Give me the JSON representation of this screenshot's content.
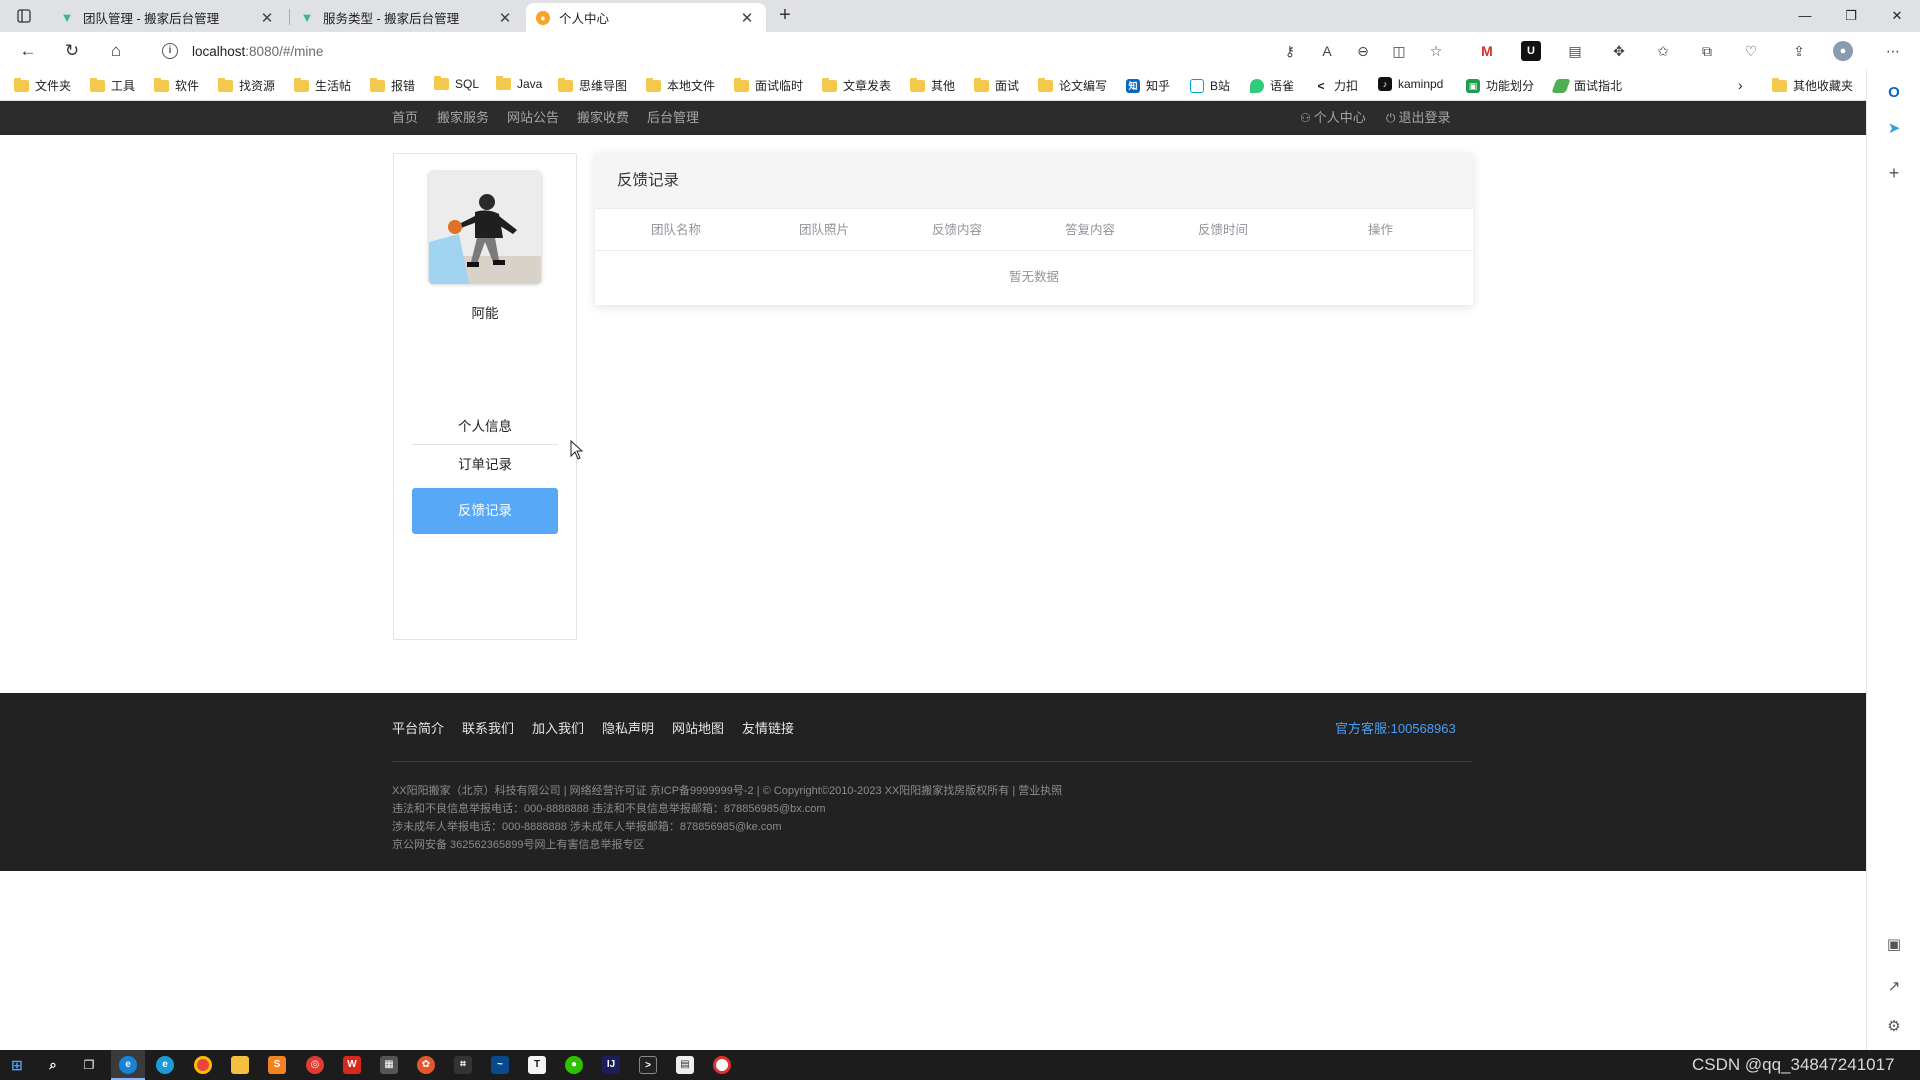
{
  "browser": {
    "tabs": [
      {
        "title": "团队管理 - 搬家后台管理",
        "active": false
      },
      {
        "title": "服务类型 - 搬家后台管理",
        "active": false
      },
      {
        "title": "个人中心",
        "active": true
      }
    ],
    "url_host": "localhost",
    "url_path": ":8080/#/mine",
    "bookmarks": [
      "文件夹",
      "工具",
      "软件",
      "找资源",
      "生活帖",
      "报错",
      "SQL",
      "Java",
      "思维导图",
      "本地文件",
      "面试临时",
      "文章发表",
      "其他",
      "面试",
      "论文编写",
      "知乎",
      "B站",
      "语雀",
      "力扣",
      "kaminpd",
      "功能划分",
      "面试指北"
    ],
    "other_bookmarks": "其他收藏夹",
    "bookmark_icons": {
      "zhihu": "知",
      "tiktok": "♪",
      "feishu": "▣"
    }
  },
  "nav": {
    "items": [
      "首页",
      "搬家服务",
      "网站公告",
      "搬家收费",
      "后台管理"
    ],
    "personal_center": "个人中心",
    "logout": "退出登录"
  },
  "profile": {
    "username": "阿能",
    "menu": [
      "个人信息",
      "订单记录",
      "反馈记录"
    ],
    "active_menu": "反馈记录"
  },
  "feedback": {
    "title": "反馈记录",
    "columns": [
      "团队名称",
      "团队照片",
      "反馈内容",
      "答复内容",
      "反馈时间",
      "操作"
    ],
    "empty_text": "暂无数据"
  },
  "footer": {
    "links": [
      "平台简介",
      "联系我们",
      "加入我们",
      "隐私声明",
      "网站地图",
      "友情链接"
    ],
    "service": "官方客服:100568963",
    "lines": [
      "XX阳阳搬家（北京）科技有限公司 | 网络经营许可证 京ICP备9999999号-2 | © Copyright©2010-2023 XX阳阳搬家找房版权所有 | 营业执照",
      "违法和不良信息举报电话：000-8888888 违法和不良信息举报邮箱：878856985@bx.com",
      "涉未成年人举报电话：000-8888888 涉未成年人举报邮箱：878856985@ke.com",
      "京公网安备 362562365899号网上有害信息举报专区"
    ]
  },
  "watermark": "CSDN @qq_34847241017",
  "colors": {
    "accent": "#57a9f7",
    "nav_bg": "#2c2c2c",
    "footer_bg": "#222222",
    "service": "#4a9ff5"
  }
}
